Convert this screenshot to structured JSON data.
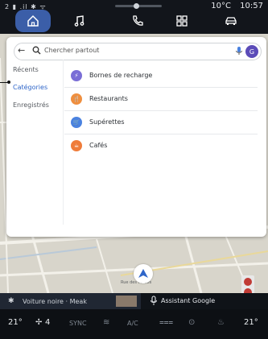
{
  "status_bar": {
    "indicators": "2 ▮ .il ✱ ᯤ",
    "temperature": "10°C",
    "time": "10:57"
  },
  "nav": {
    "tabs": [
      {
        "name": "home-icon",
        "active": true
      },
      {
        "name": "music-icon",
        "active": false
      },
      {
        "name": "phone-icon",
        "active": false
      },
      {
        "name": "apps-grid-icon",
        "active": false
      },
      {
        "name": "car-icon",
        "active": false
      }
    ]
  },
  "search": {
    "placeholder": "Chercher partout",
    "avatar_letter": "G"
  },
  "side_tabs": [
    "Récents",
    "Catégories",
    "Enregistrés"
  ],
  "categories": [
    {
      "label": "Bornes de recharge",
      "color": "#7a6ed6"
    },
    {
      "label": "Restaurants",
      "color": "#ef8f3f"
    },
    {
      "label": "Supérettes",
      "color": "#4a82e0"
    },
    {
      "label": "Cafés",
      "color": "#ef7c3a"
    }
  ],
  "map": {
    "street_label": "Rue des Fossés"
  },
  "media": {
    "title": "Voiture noire · Meak"
  },
  "assistant": {
    "label": "Assistant Google"
  },
  "climate": {
    "left_temp": "21°",
    "fan": "4",
    "sync": "SYNC",
    "ac": "A/C",
    "right_temp": "21°"
  },
  "colors": {
    "accent": "#3b5ea8",
    "active_tab": "#2f66c9"
  }
}
